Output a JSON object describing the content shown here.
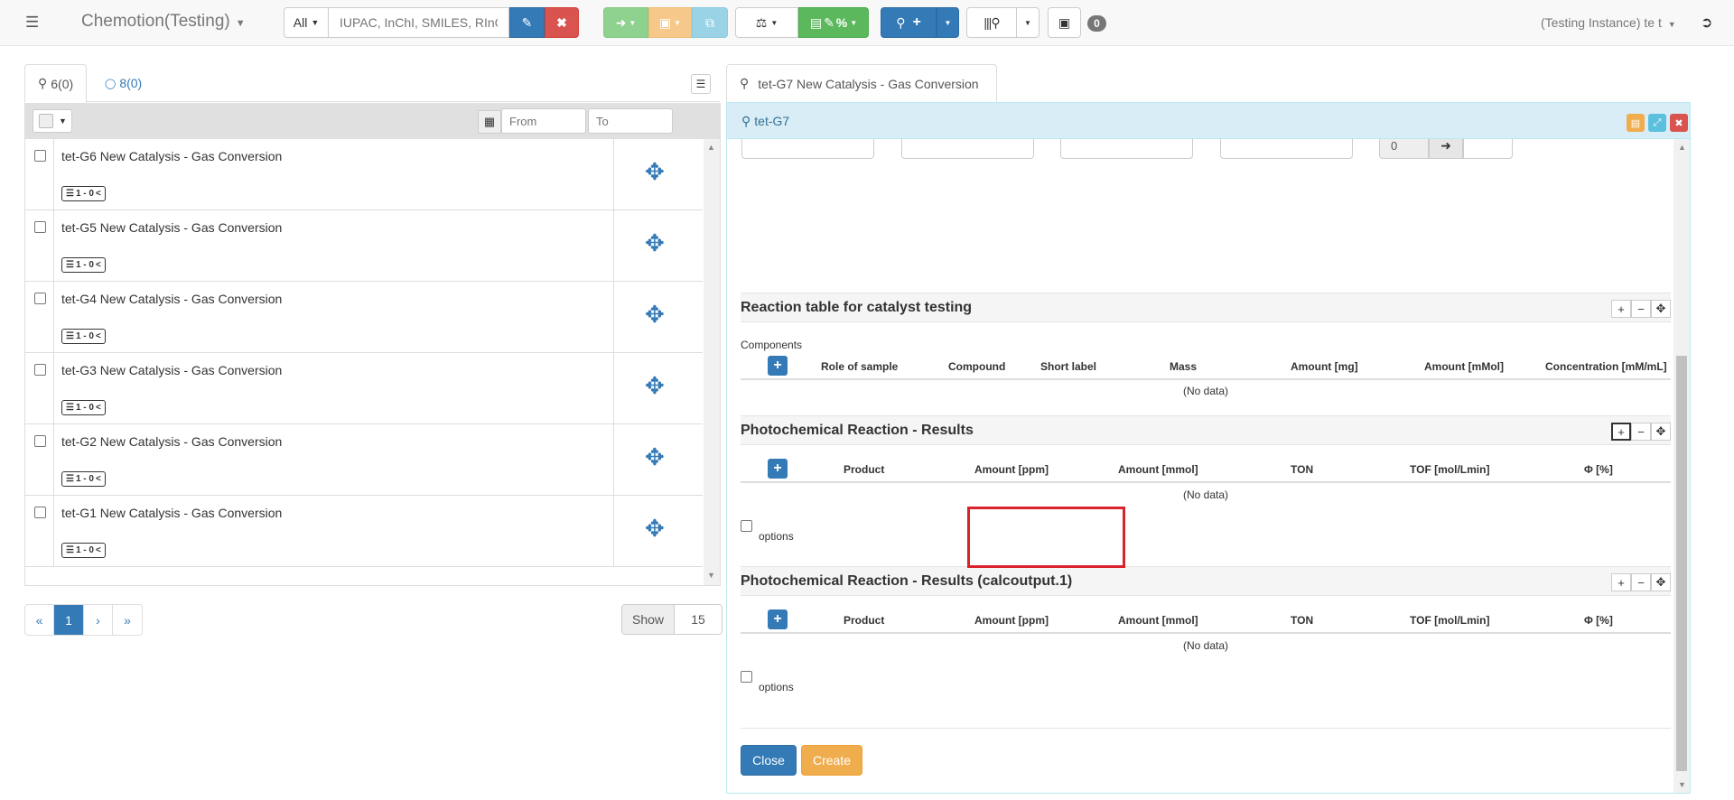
{
  "navbar": {
    "brand": "Chemotion(Testing)",
    "search_scope": "All",
    "search_placeholder": "IUPAC, InChI, SMILES, RInChI...",
    "inbox_count": "0",
    "user_menu": "(Testing Instance) te t"
  },
  "left_panel": {
    "tabs": [
      {
        "label": "6(0)",
        "icon": "flask-icon"
      },
      {
        "label": "8(0)",
        "icon": "reaction-icon"
      }
    ],
    "date_from_placeholder": "From",
    "date_to_placeholder": "To",
    "rows": [
      {
        "title": "tet-G6 New Catalysis - Gas Conversion",
        "badge": "1 - 0"
      },
      {
        "title": "tet-G5 New Catalysis - Gas Conversion",
        "badge": "1 - 0"
      },
      {
        "title": "tet-G4 New Catalysis - Gas Conversion",
        "badge": "1 - 0"
      },
      {
        "title": "tet-G3 New Catalysis - Gas Conversion",
        "badge": "1 - 0"
      },
      {
        "title": "tet-G2 New Catalysis - Gas Conversion",
        "badge": "1 - 0"
      },
      {
        "title": "tet-G1 New Catalysis - Gas Conversion",
        "badge": "1 - 0"
      }
    ],
    "pagination": {
      "first": "«",
      "current": "1",
      "next": "›",
      "last": "»"
    },
    "show_label": "Show",
    "show_value": "15"
  },
  "detail": {
    "tab_label": "tet-G7 New Catalysis - Gas Conversion",
    "header_title": "tet-G7",
    "number_value": "0",
    "sections": {
      "reaction_table": {
        "title": "Reaction table for catalyst testing",
        "components_label": "Components",
        "columns": [
          "Role of sample",
          "Compound",
          "Short label",
          "Mass",
          "Amount [mg]",
          "Amount [mMol]",
          "Concentration [mM/mL]"
        ],
        "empty": "(No data)"
      },
      "results": {
        "title": "Photochemical Reaction - Results",
        "columns": [
          "Product",
          "Amount [ppm]",
          "Amount [mmol]",
          "TON",
          "TOF [mol/Lmin]",
          "Φ [%]"
        ],
        "empty": "(No data)",
        "options_label": "options"
      },
      "results_calc": {
        "title": "Photochemical Reaction - Results (calcoutput.1)",
        "columns": [
          "Product",
          "Amount [ppm]",
          "Amount [mmol]",
          "TON",
          "TOF [mol/Lmin]",
          "Φ [%]"
        ],
        "empty": "(No data)",
        "options_label": "options"
      }
    },
    "close_label": "Close",
    "create_label": "Create"
  },
  "colors": {
    "primary": "#337ab7",
    "danger": "#d9534f",
    "warning": "#f0ad4e",
    "success": "#5cb85c",
    "info": "#5bc0de",
    "highlight": "#d9232d"
  }
}
